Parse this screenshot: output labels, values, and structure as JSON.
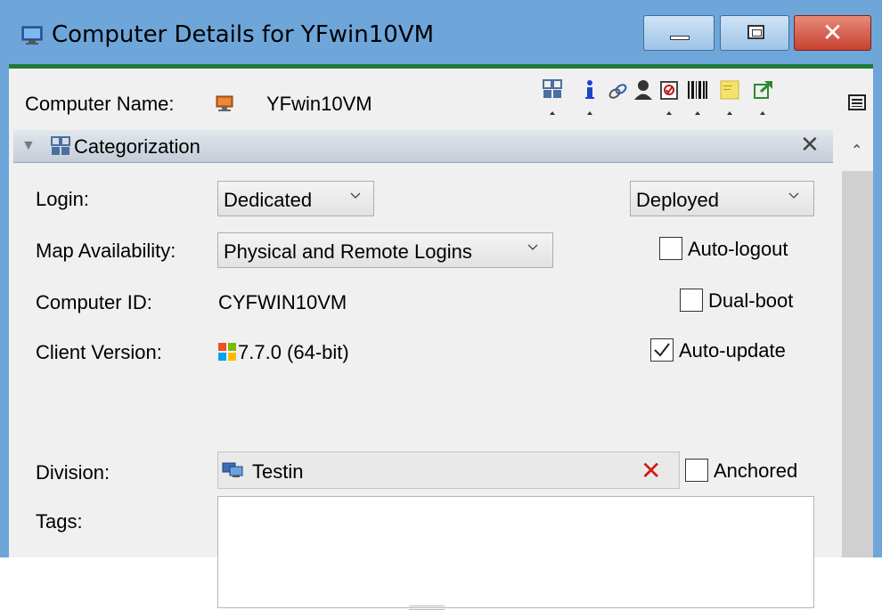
{
  "window": {
    "title": "Computer Details for YFwin10VM",
    "min_icon": "minimize-icon",
    "max_icon": "maximize-icon",
    "close_icon": "close-icon"
  },
  "header": {
    "computer_name_label": "Computer Name:",
    "computer_name_value": "YFwin10VM",
    "toolbar_icons": [
      "categorization-icon",
      "info-icon",
      "link-icon",
      "user-icon",
      "checklist-icon",
      "barcode-icon",
      "note-icon",
      "external-link-icon"
    ],
    "list_view_icon": "list-view-icon"
  },
  "section": {
    "title": "Categorization",
    "collapse_icon": "triangle-down-icon",
    "close_icon": "close-icon"
  },
  "form": {
    "login_label": "Login:",
    "login_value": "Dedicated",
    "status_value": "Deployed",
    "map_label": "Map Availability:",
    "map_value": "Physical and Remote Logins",
    "computer_id_label": "Computer ID:",
    "computer_id_value": "CYFWIN10VM",
    "client_version_label": "Client Version:",
    "client_version_value": "7.7.0 (64-bit)",
    "division_label": "Division:",
    "division_value": "Testin",
    "tags_label": "Tags:",
    "tags_value": ""
  },
  "checkboxes": {
    "auto_logout": {
      "label": "Auto-logout",
      "checked": false
    },
    "dual_boot": {
      "label": "Dual-boot",
      "checked": false
    },
    "auto_update": {
      "label": "Auto-update",
      "checked": true
    },
    "anchored": {
      "label": "Anchored",
      "checked": false
    }
  },
  "colors": {
    "titlebar": "#6ea6da",
    "accent_line": "#1f7a3a",
    "close_button": "#c7412f",
    "clear_x": "#d11a1a"
  }
}
